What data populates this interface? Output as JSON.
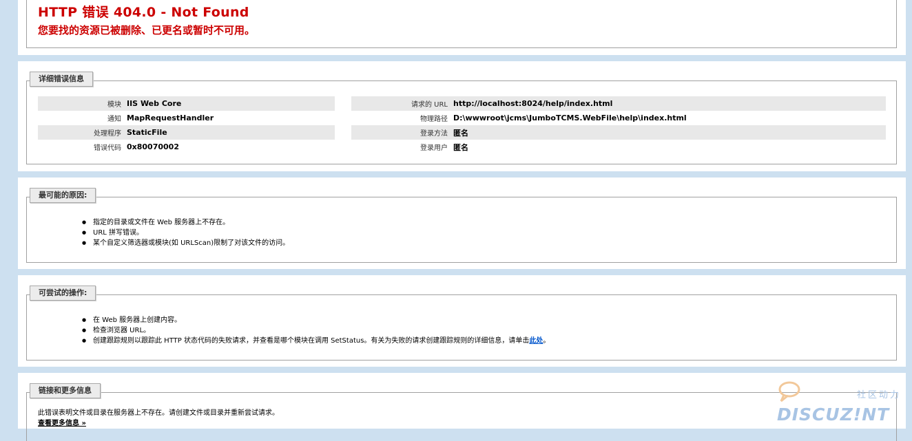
{
  "header": {
    "title": "HTTP 错误 404.0 - Not Found",
    "subtitle": "您要找的资源已被删除、已更名或暂时不可用。"
  },
  "detail": {
    "legend": "详细错误信息",
    "left": [
      {
        "label": "模块",
        "value": "IIS Web Core"
      },
      {
        "label": "通知",
        "value": "MapRequestHandler"
      },
      {
        "label": "处理程序",
        "value": "StaticFile"
      },
      {
        "label": "错误代码",
        "value": "0x80070002"
      }
    ],
    "right": [
      {
        "label": "请求的 URL",
        "value": "http://localhost:8024/help/index.html"
      },
      {
        "label": "物理路径",
        "value": "D:\\wwwroot\\jcms\\JumboTCMS.WebFile\\help\\index.html"
      },
      {
        "label": "登录方法",
        "value": "匿名"
      },
      {
        "label": "登录用户",
        "value": "匿名"
      }
    ]
  },
  "causes": {
    "legend": "最可能的原因:",
    "items": [
      "指定的目录或文件在 Web 服务器上不存在。",
      "URL 拼写错误。",
      "某个自定义筛选器或模块(如 URLScan)限制了对该文件的访问。"
    ]
  },
  "actions": {
    "legend": "可尝试的操作:",
    "items": [
      "在 Web 服务器上创建内容。",
      "检查浏览器 URL。"
    ],
    "last_item_prefix": "创建跟踪规则以跟踪此 HTTP 状态代码的失败请求，并查看是哪个模块在调用 SetStatus。有关为失败的请求创建跟踪规则的详细信息，请单击",
    "link_text": "此处",
    "last_item_suffix": "。"
  },
  "links": {
    "legend": "链接和更多信息",
    "text": "此错误表明文件或目录在服务器上不存在。请创建文件或目录并重新尝试请求。",
    "more_link": "查看更多信息 »"
  },
  "watermark": {
    "text": "DISCUZ!NT",
    "cn": "社区动力"
  },
  "colors": {
    "background": "#cde0f0",
    "error_red": "#cc0000",
    "link_blue": "#0055cc"
  }
}
